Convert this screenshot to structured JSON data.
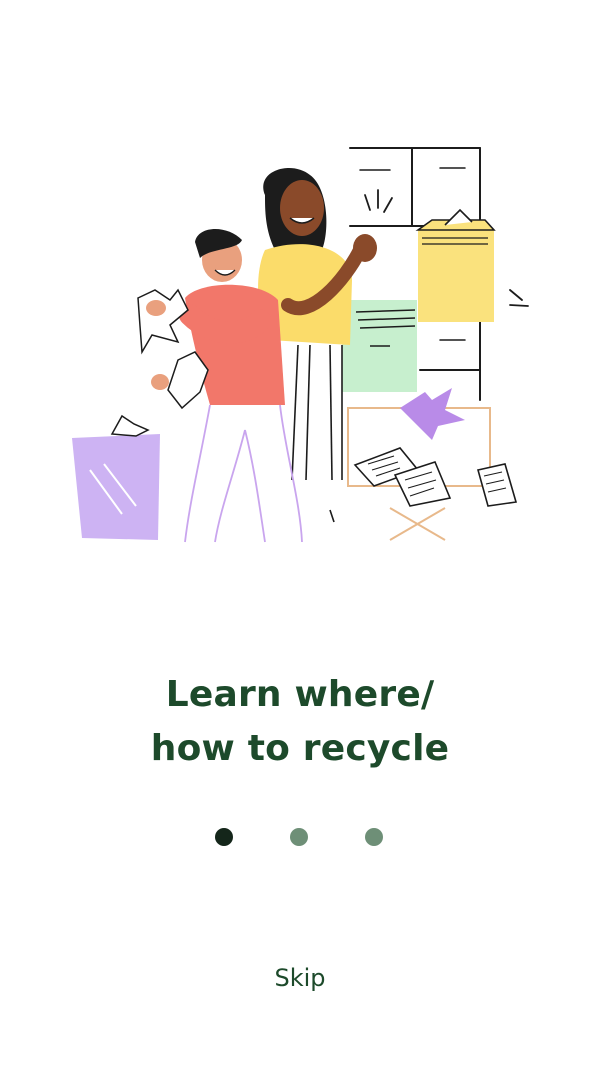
{
  "onboarding": {
    "title_line1": "Learn where/",
    "title_line2": "how to recycle",
    "skip_label": "Skip",
    "page_count": 3,
    "current_page": 1
  },
  "colors": {
    "heading": "#1d4a2b",
    "dot_active": "#14261a",
    "dot_inactive": "#6e8f77",
    "bin_purple": "#cdb3f3",
    "box_yellow": "#fae27d",
    "drawer_green": "#c7efce",
    "shirt_coral": "#f2776a",
    "shirt_yellow": "#fbdc6a",
    "paper_purple": "#b98be8",
    "cardboard_tan": "#e8b98b"
  },
  "illustration": {
    "subject": "two people sorting paper and boxes for recycling"
  }
}
